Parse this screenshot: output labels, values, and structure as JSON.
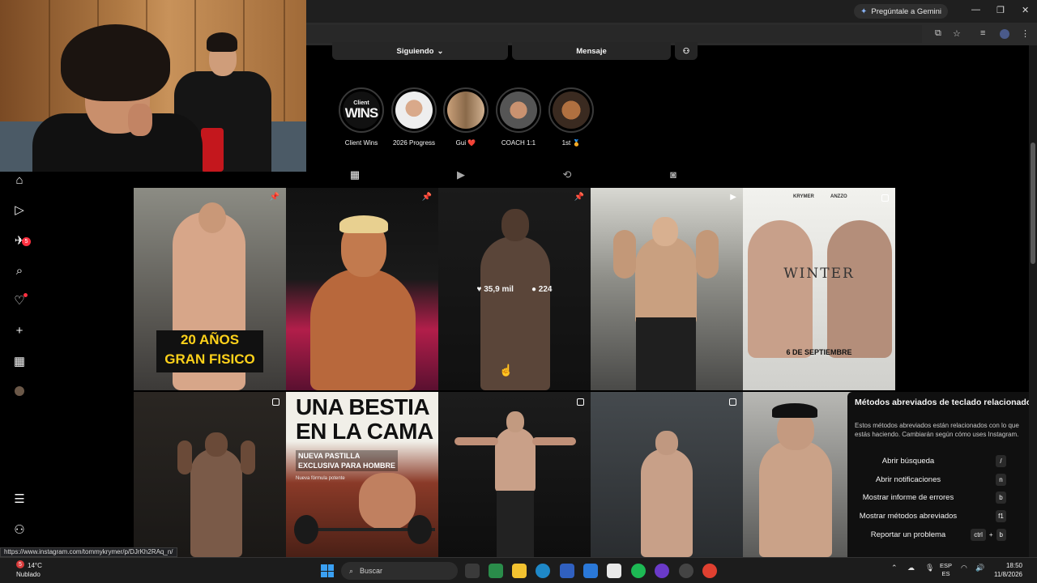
{
  "browser": {
    "gemini_label": "Pregúntale a Gemini",
    "icons": [
      "minimize-icon",
      "restore-icon",
      "close-icon",
      "install-icon",
      "star-icon",
      "media-icon",
      "profile-icon",
      "menu-icon"
    ]
  },
  "profile": {
    "following_label": "Siguiendo",
    "message_label": "Mensaje",
    "highlights": [
      {
        "label": "Client Wins",
        "badge_top": "Client",
        "badge_main": "WINS"
      },
      {
        "label": "2026 Progress"
      },
      {
        "label": "Gui ❤️"
      },
      {
        "label": "COACH 1:1"
      },
      {
        "label": "1st 🏅"
      }
    ],
    "tabs": [
      "posts",
      "reels",
      "reposts",
      "tagged"
    ]
  },
  "grid": {
    "tile1_caption_line1": "20 AÑOS",
    "tile1_caption_line2": "GRAN FISICO",
    "hover_likes": "35,9 mil",
    "hover_comments": "224",
    "winter_names_left": "KRYMER",
    "winter_names_right": "ANZZO",
    "winter_title": "WINTER",
    "winter_date": "6 DE SEPTIEMBRE",
    "bestia_line1": "UNA BESTIA",
    "bestia_line2": "EN LA CAMA",
    "bestia_sub1": "NUEVA PASTILLA",
    "bestia_sub2": "EXCLUSIVA PARA HOMBRE",
    "bestia_small": "Nueva fórmula potente"
  },
  "shortcuts": {
    "title": "Métodos abreviados de teclado relacionados",
    "description": "Estos métodos abreviados están relacionados con lo que estás haciendo. Cambiarán según cómo uses Instagram.",
    "items": [
      {
        "label": "Abrir búsqueda",
        "key": "/"
      },
      {
        "label": "Abrir notificaciones",
        "key": "n"
      },
      {
        "label": "Mostrar informe de errores",
        "key": "b"
      },
      {
        "label": "Mostrar métodos abreviados",
        "key": "f1"
      },
      {
        "label": "Reportar un problema",
        "key1": "ctrl",
        "plus": "+",
        "key2": "b"
      }
    ]
  },
  "nav": {
    "messages_badge": "5"
  },
  "status_url": "https://www.instagram.com/tommykrymer/p/DJrKh2RAq_n/",
  "taskbar": {
    "weather_temp": "14°C",
    "weather_desc": "Nublado",
    "weather_badge": "5",
    "search_placeholder": "Buscar",
    "lang_line1": "ESP",
    "lang_line2": "ES",
    "time": "18:50",
    "date": "11/8/2026"
  },
  "colors": {
    "accent_red": "#ff3040",
    "background": "#000000",
    "panel": "#262626"
  }
}
